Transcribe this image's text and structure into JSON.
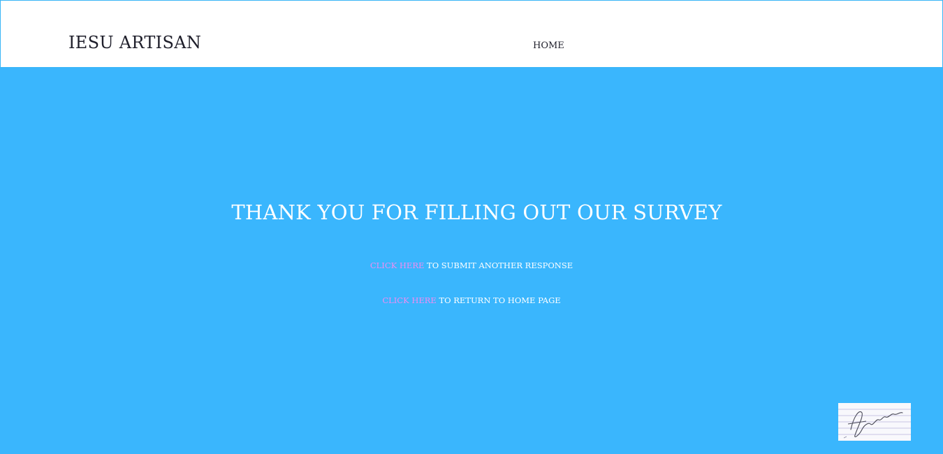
{
  "header": {
    "brand": "IESU ARTISAN",
    "nav": {
      "home_label": "HOME"
    }
  },
  "main": {
    "headline": "THANK YOU FOR FILLING OUT OUR SURVEY",
    "submit_another": {
      "link_label": "CLICK HERE",
      "text": " TO SUBMIT ANOTHER RESPONSE"
    },
    "return_home": {
      "link_label": "CLICK HERE",
      "text": " TO RETURN TO  HOME PAGE"
    }
  },
  "colors": {
    "background": "#3ab6fd",
    "header_bg": "#ffffff",
    "link": "#f18cf2",
    "text_dark": "#1e1e2a",
    "text_light": "#ffffff"
  },
  "badge": {
    "signature": "Aguero"
  }
}
